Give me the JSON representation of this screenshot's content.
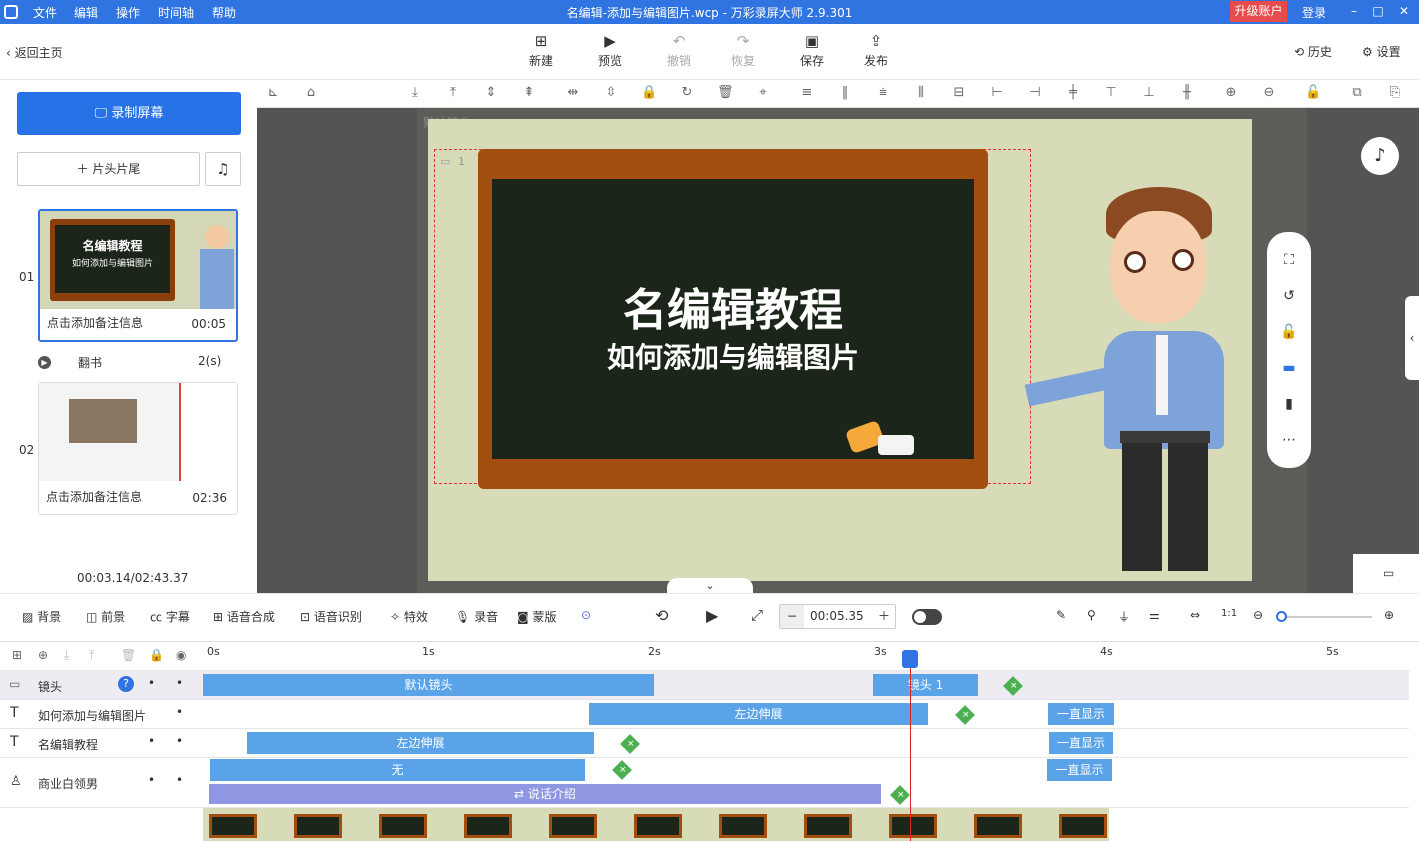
{
  "titlebar": {
    "menus": [
      "文件",
      "编辑",
      "操作",
      "时间轴",
      "帮助"
    ],
    "title": "名编辑-添加与编辑图片.wcp - 万彩录屏大师 2.9.301",
    "upgrade": "升级账户",
    "login": "登录"
  },
  "toolbar": {
    "back": "返回主页",
    "new": "新建",
    "preview": "预览",
    "undo": "撤销",
    "redo": "恢复",
    "save": "保存",
    "publish": "发布",
    "history": "历史",
    "settings": "设置"
  },
  "left": {
    "record": "录制屏幕",
    "title_tail": "片头片尾",
    "slides": [
      {
        "num": "01",
        "caption": "点击添加备注信息",
        "duration": "00:05",
        "t1": "名编辑教程",
        "t2": "如何添加与编辑图片"
      },
      {
        "num": "02",
        "caption": "点击添加备注信息",
        "duration": "02:36"
      }
    ],
    "transition_name": "翻书",
    "transition_dur": "2(s)",
    "time_total": "00:03.14/02:43.37"
  },
  "canvas": {
    "default_lens": "默认镜头",
    "lens_num": "1",
    "title1": "名编辑教程",
    "title2": "如何添加与编辑图片"
  },
  "bottom": {
    "bg": "背景",
    "fg": "前景",
    "subtitle": "字幕",
    "tts": "语音合成",
    "asr": "语音识别",
    "fx": "特效",
    "record": "录音",
    "mask": "蒙版",
    "time": "00:05.35"
  },
  "timeline": {
    "ticks": [
      "0s",
      "1s",
      "2s",
      "3s",
      "4s",
      "5s"
    ],
    "tracks": [
      {
        "name": "镜头",
        "bars": [
          "默认镜头",
          "镜头 1"
        ]
      },
      {
        "name": "如何添加与编辑图片",
        "bars": [
          "左边伸展",
          "一直显示"
        ]
      },
      {
        "name": "名编辑教程",
        "bars": [
          "左边伸展",
          "一直显示"
        ]
      },
      {
        "name": "商业白领男",
        "bars": [
          "无",
          "一直显示",
          "说话介绍"
        ]
      }
    ]
  }
}
